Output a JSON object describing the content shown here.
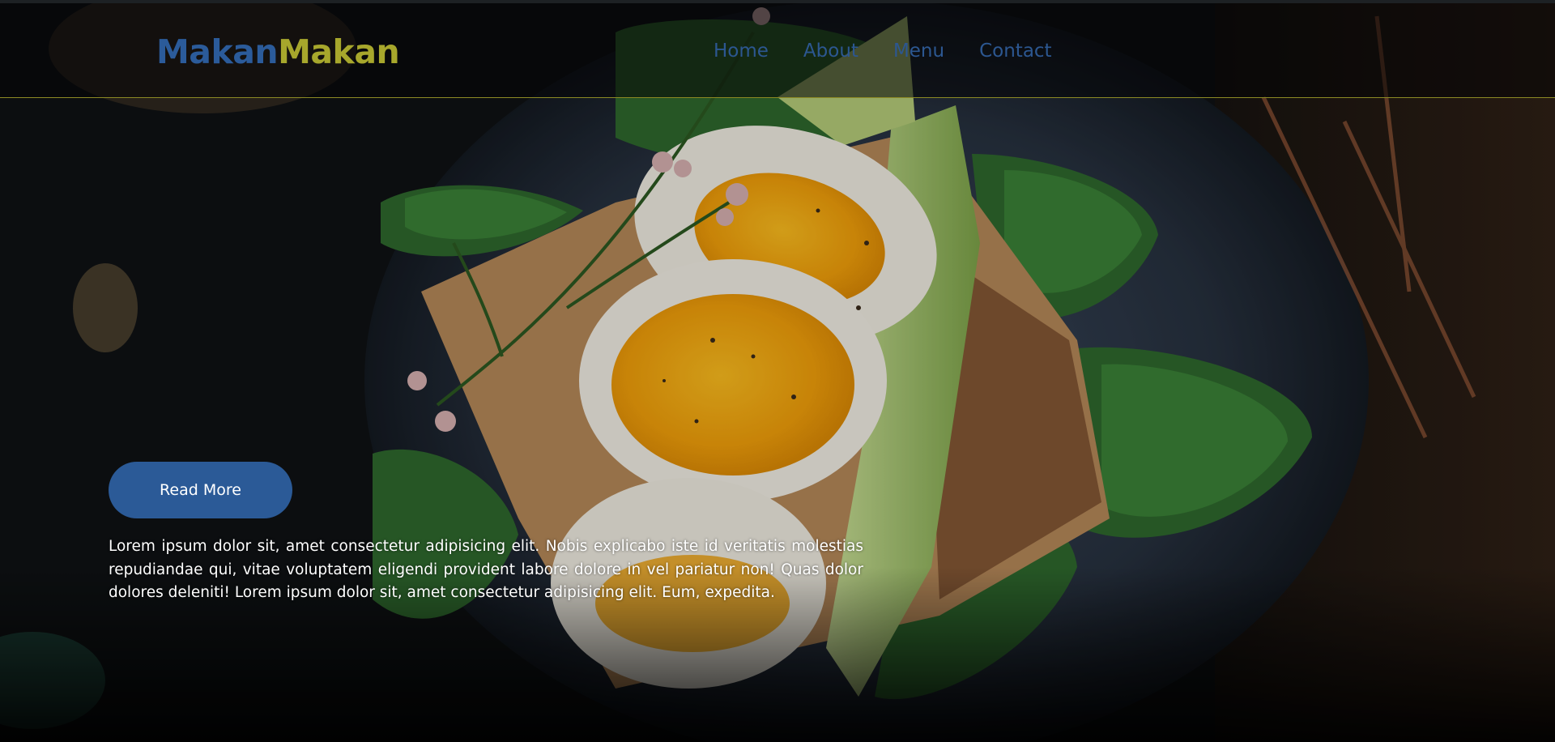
{
  "brand": {
    "part1": "Makan",
    "part2": "Makan"
  },
  "nav": {
    "items": [
      {
        "label": "Home"
      },
      {
        "label": "About"
      },
      {
        "label": "Menu"
      },
      {
        "label": "Contact"
      }
    ]
  },
  "hero": {
    "button_label": "Read More",
    "body": "Lorem ipsum dolor sit, amet consectetur adipisicing elit. Nobis explicabo iste id veritatis molestias repudiandae qui, vitae voluptatem eligendi provident labore dolore in vel pariatur non! Quas dolor dolores deleniti! Lorem ipsum dolor sit, amet consectetur adipisicing elit. Eum, expedita."
  },
  "colors": {
    "brand_blue": "#2b5b9a",
    "brand_olive": "#a7a72c",
    "nav_link": "#2c5791",
    "button_bg": "#2b5a97",
    "navbar_border": "#8c8a24"
  }
}
